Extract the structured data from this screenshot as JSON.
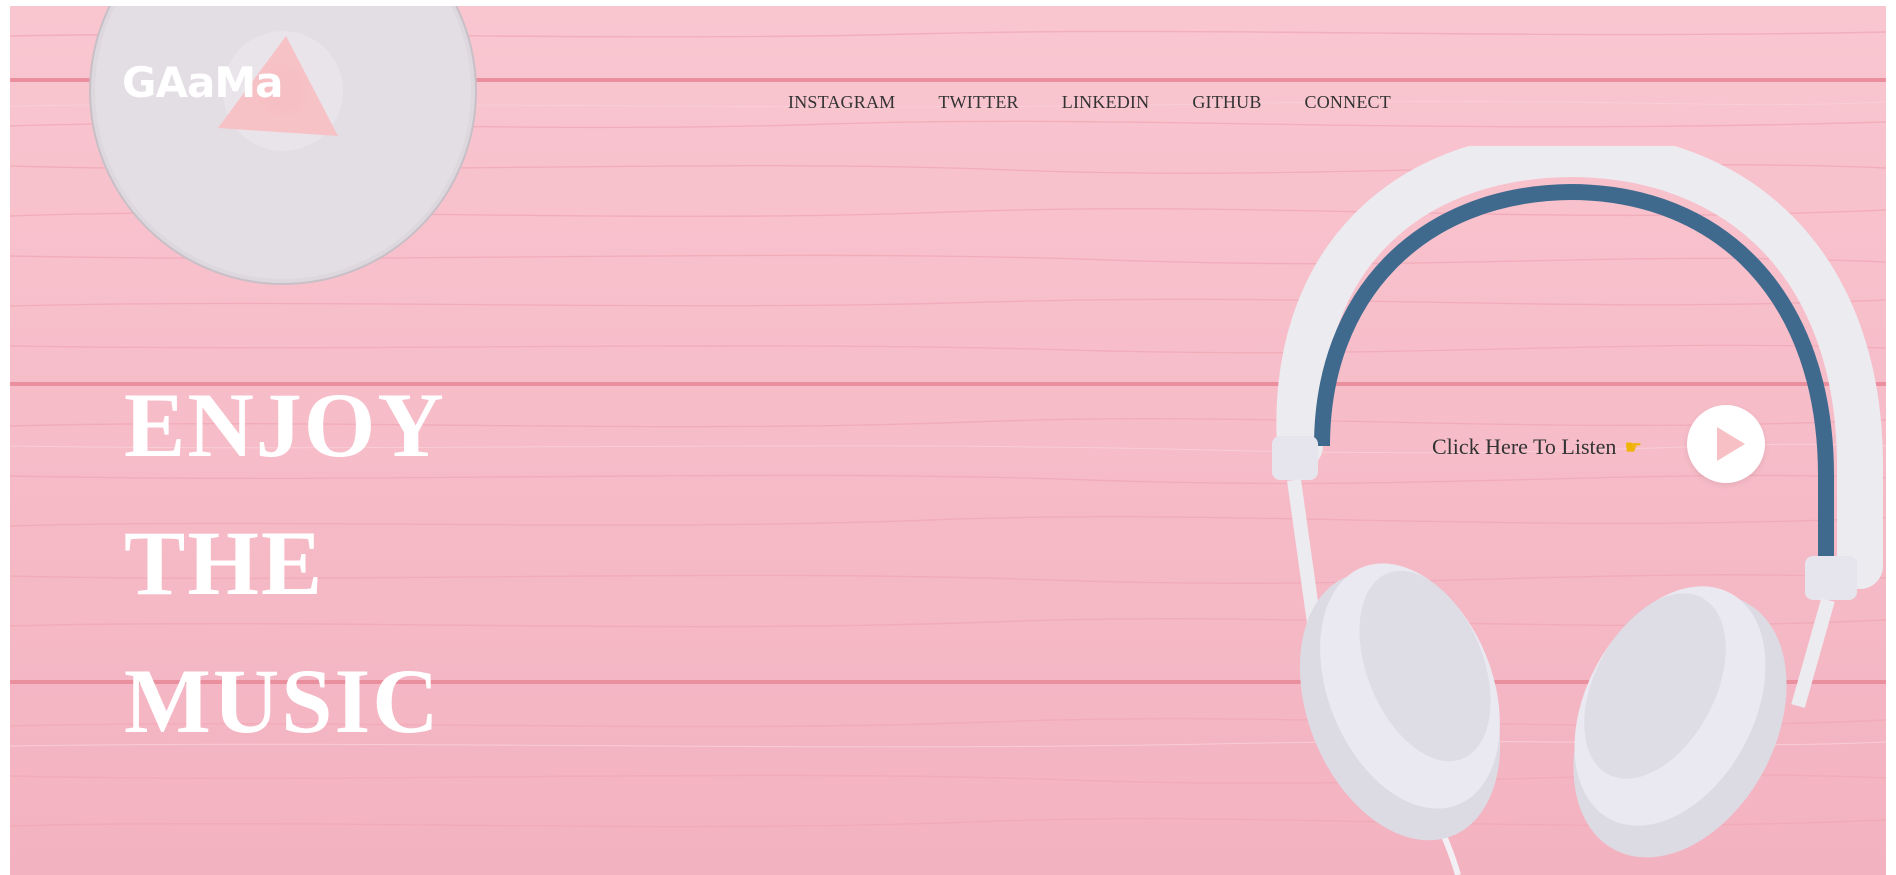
{
  "brand": {
    "logo_text": "GAaMa",
    "accent_color": "#f7c0c4",
    "background_color": "#f6bcc8"
  },
  "nav": {
    "items": [
      {
        "label": "INSTAGRAM"
      },
      {
        "label": "TWITTER"
      },
      {
        "label": "LINKEDIN"
      },
      {
        "label": "GITHUB"
      },
      {
        "label": "CONNECT"
      }
    ]
  },
  "hero": {
    "lines": [
      "ENJOY",
      "THE",
      "MUSIC"
    ]
  },
  "listen": {
    "label": "Click Here To Listen",
    "hand_icon": "pointing-hand-icon",
    "button_icon": "play-icon"
  },
  "decor": {
    "disc_icon": "cd-disc",
    "image": "headphones-illustration"
  }
}
